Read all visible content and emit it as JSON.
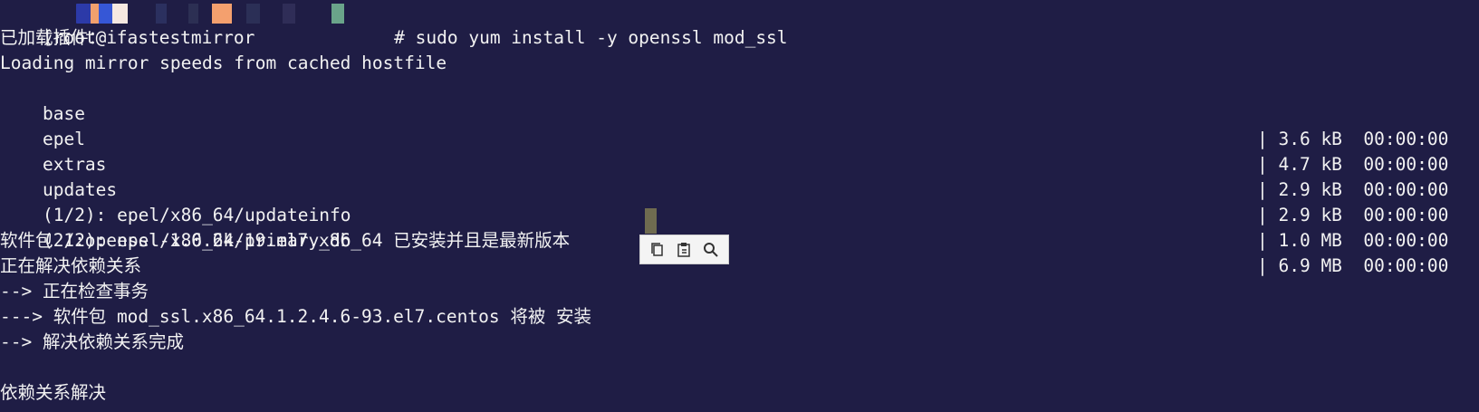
{
  "prompt_command": "# sudo yum install -y openssl mod_ssl",
  "prompt_prefix": "[root@i",
  "lines": [
    "已加载插件： fastestmirror",
    "Loading mirror speeds from cached hostfile",
    "base",
    "epel",
    "extras",
    "updates",
    "(1/2): epel/x86_64/updateinfo",
    "(2/2): epel/x86_64/primary_db",
    "软件包 1:openssl-1.0.2k-19.el7.x86_64 已安装并且是最新版本",
    "正在解决依赖关系",
    "--> 正在检查事务",
    "---> 软件包 mod_ssl.x86_64.1.2.4.6-93.el7.centos 将被 安装",
    "--> 解决依赖关系完成",
    "",
    "依赖关系解决"
  ],
  "right_columns": [
    "| 3.6 kB  00:00:00",
    "| 4.7 kB  00:00:00",
    "| 2.9 kB  00:00:00",
    "| 2.9 kB  00:00:00",
    "| 1.0 MB  00:00:00",
    "| 6.9 MB  00:00:00"
  ],
  "icons": {
    "copy": "copy-icon",
    "paste": "paste-icon",
    "search": "search-icon"
  },
  "colors": {
    "background": "#1f1d45",
    "foreground": "#f2f2f2",
    "toolbar": "#f4f4f4"
  }
}
